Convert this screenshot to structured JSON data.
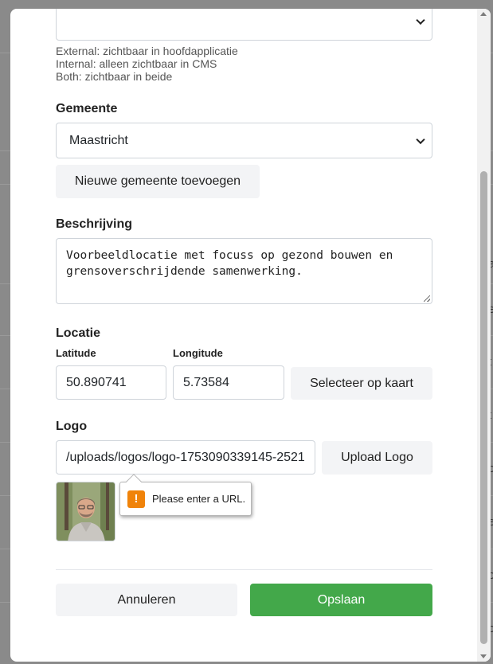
{
  "form": {
    "visibility_hint": {
      "line1": "External: zichtbaar in hoofdapplicatie",
      "line2": "Internal: alleen zichtbaar in CMS",
      "line3": "Both: zichtbaar in beide"
    },
    "gemeente": {
      "label": "Gemeente",
      "selected": "Maastricht",
      "add_button": "Nieuwe gemeente toevoegen"
    },
    "beschrijving": {
      "label": "Beschrijving",
      "value_line1": "Voorbeeldlocatie met focuss op gezond bouwen en",
      "value_line2": "grensoverschrijdende samenwerking."
    },
    "locatie": {
      "label": "Locatie",
      "latitude_label": "Latitude",
      "latitude_value": "50.890741",
      "longitude_label": "Longitude",
      "longitude_value": "5.73584",
      "map_button": "Selecteer op kaart"
    },
    "logo": {
      "label": "Logo",
      "url_value": "/uploads/logos/logo-1753090339145-2521",
      "upload_button": "Upload Logo",
      "validation_message": "Please enter a URL."
    },
    "actions": {
      "cancel": "Annuleren",
      "save": "Opslaan"
    }
  },
  "background_page": {
    "edge_glyphs": [
      "a",
      "e",
      "t",
      "t",
      "o",
      "e",
      "o",
      "o"
    ]
  },
  "colors": {
    "primary": "#43a84a",
    "warning": "#f0830a"
  }
}
